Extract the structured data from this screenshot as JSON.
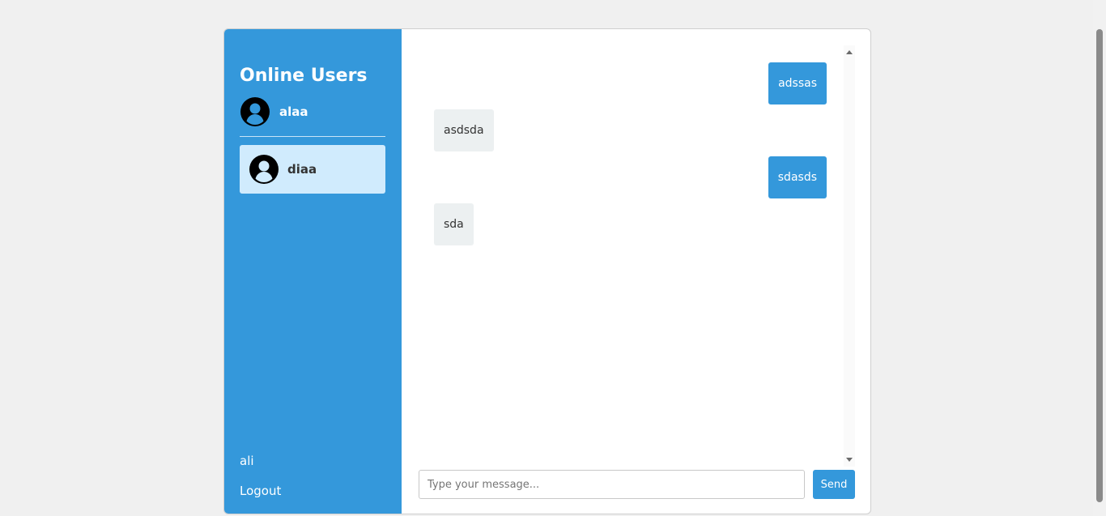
{
  "sidebar": {
    "title": "Online Users",
    "current_user": {
      "name": "alaa",
      "avatar_icon": "user-circle-icon"
    },
    "users": [
      {
        "name": "diaa",
        "avatar_icon": "user-circle-icon",
        "selected": true
      }
    ],
    "footer": {
      "username": "ali",
      "logout_label": "Logout"
    }
  },
  "chat": {
    "messages": [
      {
        "text": "adssas",
        "direction": "sent"
      },
      {
        "text": "asdsda",
        "direction": "received"
      },
      {
        "text": "sdasds",
        "direction": "sent"
      },
      {
        "text": "sda",
        "direction": "received"
      }
    ],
    "input": {
      "placeholder": "Type your message...",
      "value": ""
    },
    "send_label": "Send"
  },
  "colors": {
    "accent": "#3498db",
    "selected_user_bg": "#d0ebfd",
    "received_bubble": "#ecf0f1",
    "page_bg": "#f0f0f0"
  }
}
